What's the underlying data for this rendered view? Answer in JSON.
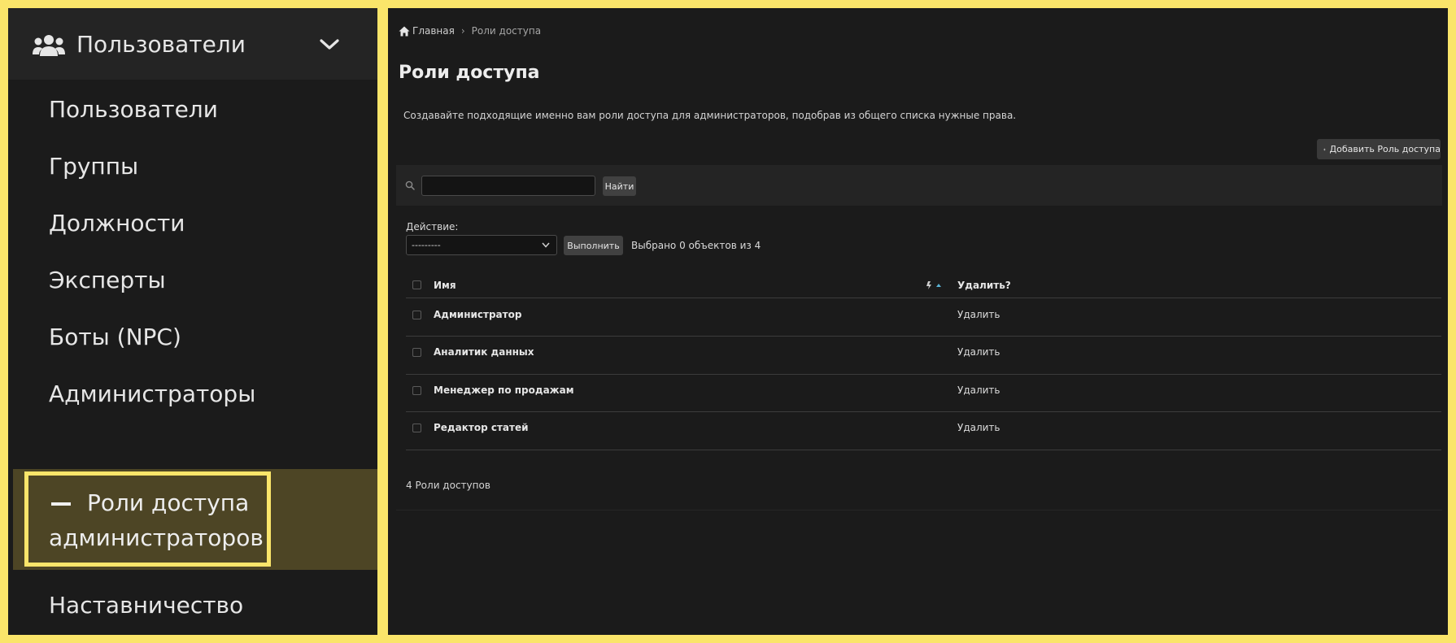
{
  "sidebar": {
    "header_label": "Пользователи",
    "header_icon": "users-icon",
    "items": [
      {
        "label": "Пользователи"
      },
      {
        "label": "Группы"
      },
      {
        "label": "Должности"
      },
      {
        "label": "Эксперты"
      },
      {
        "label": "Боты (NPC)"
      },
      {
        "label": "Администраторы"
      }
    ],
    "active_item": {
      "line1": "Роли доступа",
      "line2": "администраторов"
    },
    "after_items": [
      {
        "label": "Наставничество"
      }
    ]
  },
  "breadcrumb": {
    "home": "Главная",
    "separator": "›",
    "current": "Роли  доступа"
  },
  "page": {
    "title": "Роли доступа",
    "description": "Создавайте подходящие именно вам роли доступа для администраторов, подобрав из общего списка нужные права.",
    "add_button": "Добавить Роль доступа"
  },
  "search": {
    "value": "",
    "button": "Найти"
  },
  "actions": {
    "label": "Действие:",
    "selected": "---------",
    "run_button": "Выполнить",
    "selected_count": "Выбрано 0 объектов из 4"
  },
  "table": {
    "columns": {
      "name": "Имя",
      "delete": "Удалить?"
    },
    "rows": [
      {
        "name": "Администратор",
        "delete": "Удалить"
      },
      {
        "name": "Аналитик данных",
        "delete": "Удалить"
      },
      {
        "name": "Менеджер по продажам",
        "delete": "Удалить"
      },
      {
        "name": "Редактор статей",
        "delete": "Удалить"
      }
    ],
    "total": "4 Роли доступов"
  },
  "colors": {
    "frame": "#fae56a",
    "panel": "#1b1b1b",
    "active": "#4d4525",
    "sort_accent": "#5ab4d6"
  }
}
